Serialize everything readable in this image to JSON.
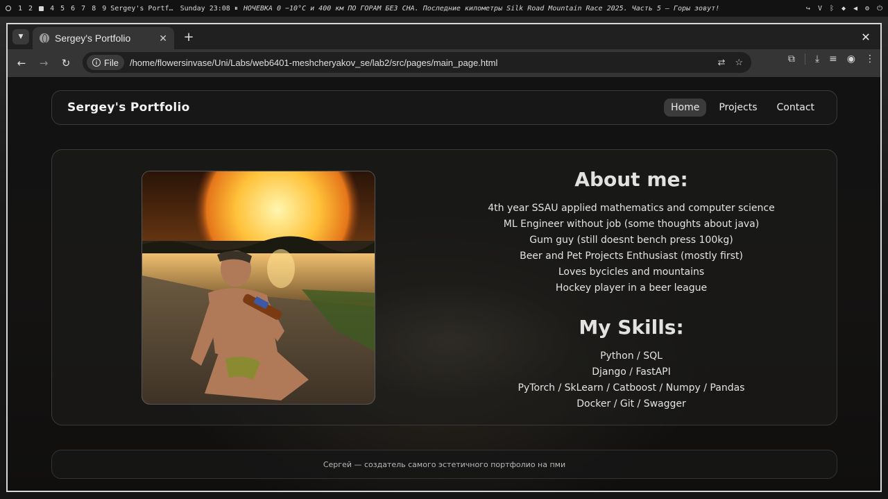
{
  "system_bar": {
    "workspaces": [
      "1",
      "2",
      "4",
      "5",
      "6",
      "7",
      "8",
      "9"
    ],
    "window_title": "Sergey's Portf…",
    "clock": "Sunday 23:08",
    "media_title": "НОЧЕВКА 0 −10°C и 400 км ПО ГОРАМ БЕЗ СНА. Последние километры Silk Road Mountain Race 2025. Часть 5 – Горы зовут!",
    "tray_text": "V"
  },
  "browser": {
    "tab_title": "Sergey's Portfolio",
    "address_scheme": "File",
    "address_url": "/home/flowersinvase/Uni/Labs/web6401-meshcheryakov_se/lab2/src/pages/main_page.html"
  },
  "page": {
    "brand": "Sergey's Portfolio",
    "nav": [
      {
        "label": "Home",
        "active": true
      },
      {
        "label": "Projects",
        "active": false
      },
      {
        "label": "Contact",
        "active": false
      }
    ],
    "about": {
      "title": "About me:",
      "lines": [
        "4th year SSAU applied mathematics and computer science",
        "ML Engineer without job (some thoughts about java)",
        "Gum guy (still doesnt bench press 100kg)",
        "Beer and Pet Projects Enthusiast (mostly first)",
        "Loves bycicles and mountains",
        "Hockey player in a beer league"
      ]
    },
    "skills": {
      "title": "My Skills:",
      "lines": [
        "Python / SQL",
        "Django / FastAPI",
        "PyTorch / SkLearn / Catboost / Numpy / Pandas",
        "Docker / Git / Swagger"
      ]
    },
    "footer": "Сергей — создатель самого эстетичного портфолио на пми"
  }
}
